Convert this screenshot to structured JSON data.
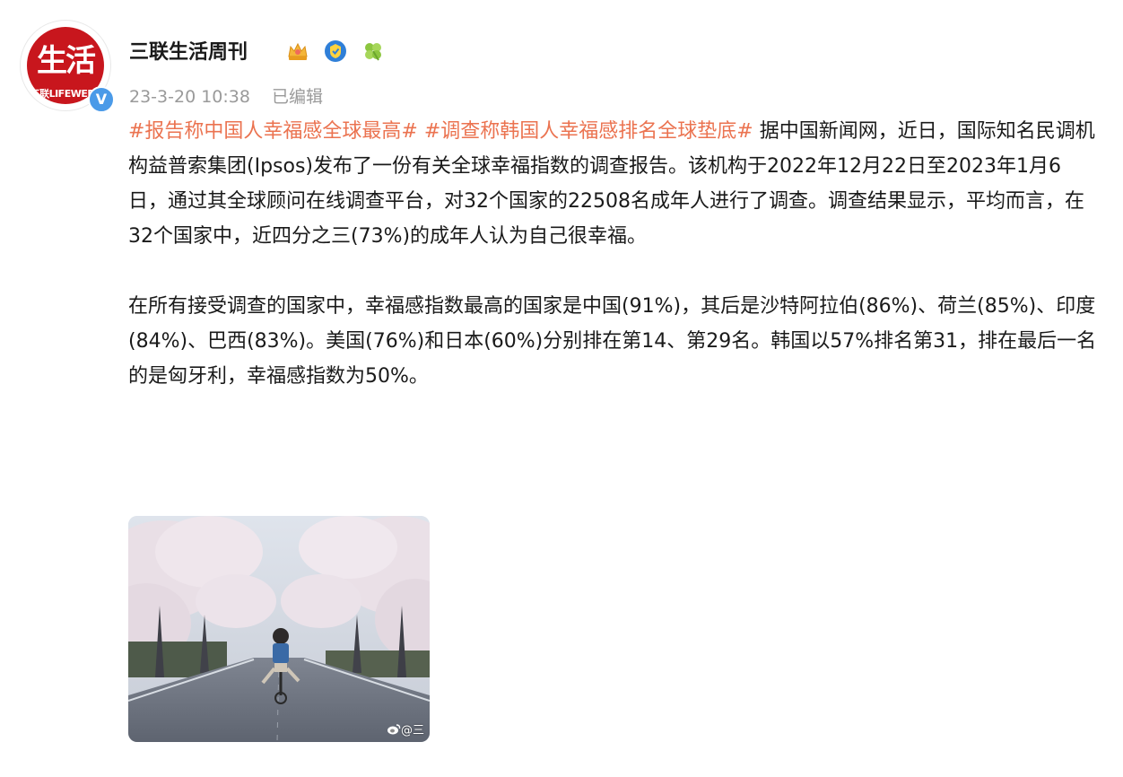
{
  "post": {
    "author": {
      "name": "三联生活周刊",
      "avatar_text": "生活",
      "avatar_subtext": "三联LIFEWEEK",
      "verified_mark": "V"
    },
    "badges": [
      "crown-badge",
      "shield-badge",
      "clover-badge"
    ],
    "meta": {
      "time": "23-3-20 10:38",
      "edited": "已编辑"
    },
    "body": {
      "hashtag_1": "#报告称中国人幸福感全球最高#",
      "hashtag_2": "#调查称韩国人幸福感排名全球垫底#",
      "para1_text": "据中国新闻网，近日，国际知名民调机构益普索集团(Ipsos)发布了一份有关全球幸福指数的调查报告。该机构于2022年12月22日至2023年1月6日，通过其全球顾问在线调查平台，对32个国家的22508名成年人进行了调查。调查结果显示，平均而言，在32个国家中，近四分之三(73%)的成年人认为自己很幸福。",
      "para2_text": "在所有接受调查的国家中，幸福感指数最高的国家是中国(91%)，其后是沙特阿拉伯(86%)、荷兰(85%)、印度(84%)、巴西(83%)。美国(76%)和日本(60%)分别排在第14、第29名。韩国以57%排名第31，排在最后一名的是匈牙利，幸福感指数为50%。"
    },
    "image": {
      "watermark": "@三"
    }
  },
  "colors": {
    "hashtag": "#eb7350",
    "meta": "#9a9a9a",
    "text": "#1a1a1a",
    "brand_red": "#c8161d",
    "verified_blue": "#4a9ae8"
  }
}
